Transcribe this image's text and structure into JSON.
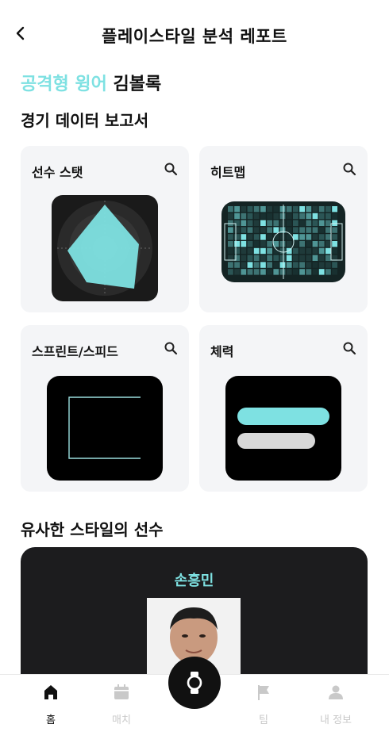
{
  "header": {
    "title": "플레이스타일 분석 레포트"
  },
  "player": {
    "style_label": "공격형 윙어",
    "name": "김볼록"
  },
  "report": {
    "title": "경기 데이터 보고서",
    "cards": [
      {
        "title": "선수 스탯"
      },
      {
        "title": "히트맵"
      },
      {
        "title": "스프린트/스피드"
      },
      {
        "title": "체력"
      }
    ]
  },
  "similar": {
    "title": "유사한 스타일의 선수",
    "player_name": "손흥민"
  },
  "tabbar": {
    "items": [
      {
        "label": "홈",
        "icon": "home-icon"
      },
      {
        "label": "매치",
        "icon": "calendar-icon"
      },
      {
        "label": "",
        "icon": "watch-icon"
      },
      {
        "label": "팀",
        "icon": "flag-icon"
      },
      {
        "label": "내 정보",
        "icon": "person-icon"
      }
    ]
  },
  "colors": {
    "accent": "#7ee1e2",
    "dark": "#111111",
    "card_bg": "#f4f5f7"
  }
}
